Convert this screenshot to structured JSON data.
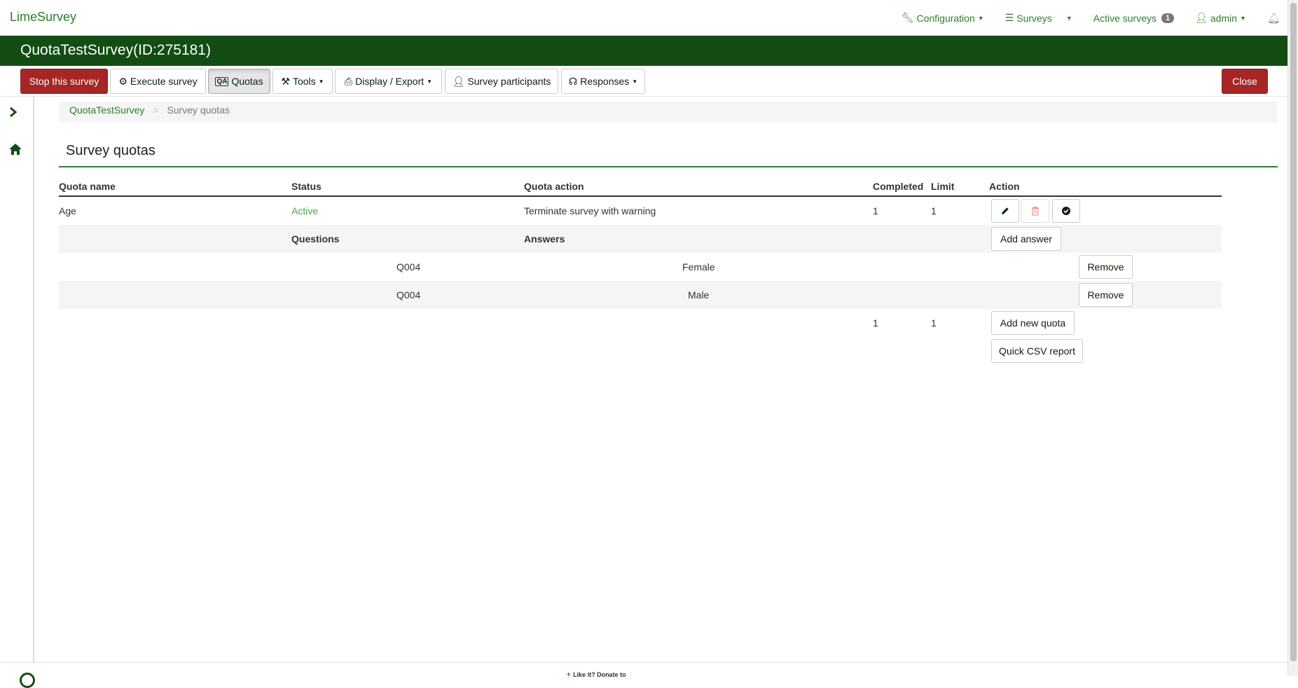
{
  "app": {
    "brand": "LimeSurvey"
  },
  "topnav": {
    "configuration": "Configuration",
    "surveys": "Surveys",
    "active_surveys": "Active surveys",
    "active_count": "1",
    "user": "admin"
  },
  "survey_title": "QuotaTestSurvey(ID:275181)",
  "toolbar": {
    "stop": "Stop this survey",
    "execute": "Execute survey",
    "quotas": "Quotas",
    "tools": "Tools",
    "display_export": "Display / Export",
    "participants": "Survey participants",
    "responses": "Responses",
    "close": "Close"
  },
  "breadcrumb": {
    "root": "QuotaTestSurvey",
    "sep": ">",
    "current": "Survey quotas"
  },
  "page_title": "Survey quotas",
  "table": {
    "headers": [
      "Quota name",
      "Status",
      "Quota action",
      "Completed",
      "Limit",
      "Action"
    ],
    "quota": {
      "name": "Age",
      "status": "Active",
      "action": "Terminate survey with warning",
      "completed": "1",
      "limit": "1"
    },
    "sub_headers": {
      "questions": "Questions",
      "answers": "Answers",
      "add_answer": "Add answer"
    },
    "answers": [
      {
        "question": "Q004",
        "answer": "Female",
        "remove": "Remove"
      },
      {
        "question": "Q004",
        "answer": "Male",
        "remove": "Remove"
      }
    ],
    "totals": {
      "completed": "1",
      "limit": "1"
    },
    "add_new_quota": "Add new quota",
    "csv_report": "Quick CSV report"
  },
  "footer": {
    "donate": "Like it? Donate to"
  },
  "colors": {
    "brand_green": "#144d14",
    "link_green": "#2a7f2a",
    "danger": "#a62626"
  }
}
